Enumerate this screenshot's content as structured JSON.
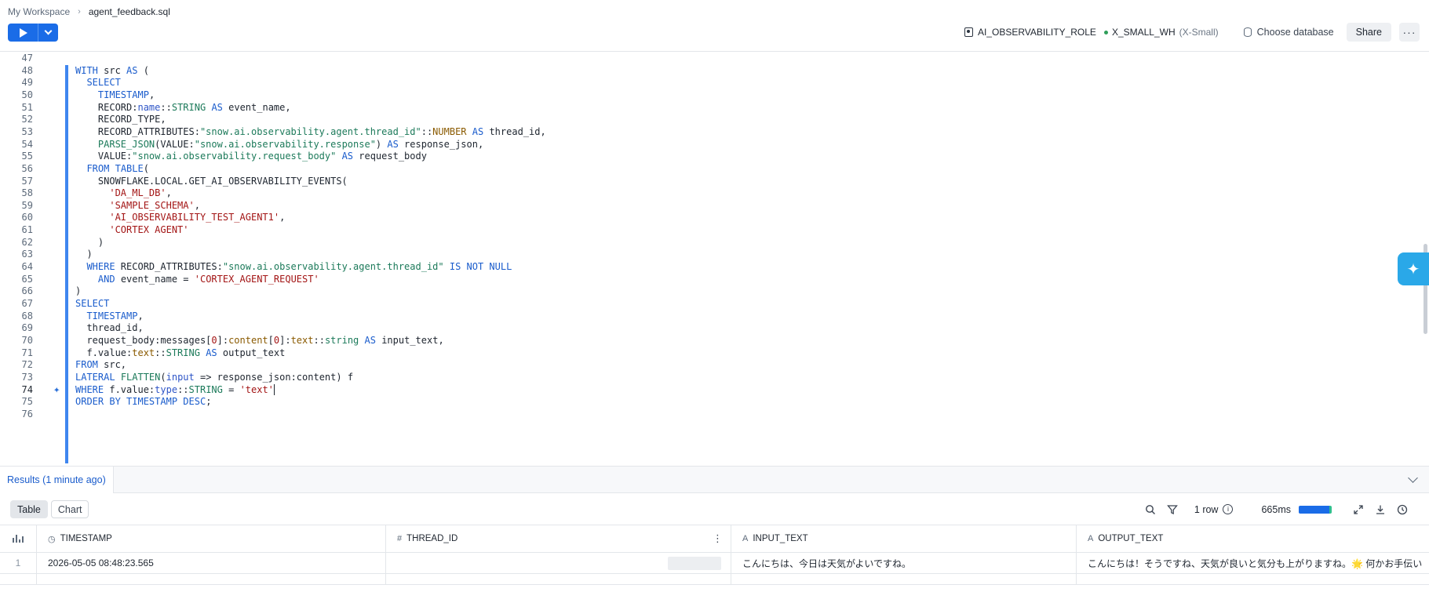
{
  "breadcrumb": {
    "workspace": "My Workspace",
    "separator": "›",
    "file": "agent_feedback.sql"
  },
  "header": {
    "role": "AI_OBSERVABILITY_ROLE",
    "warehouse": "X_SMALL_WH",
    "warehouse_size": "(X-Small)",
    "database_placeholder": "Choose database",
    "share_label": "Share",
    "more_label": "···"
  },
  "editor": {
    "active_line": 74,
    "lines": [
      {
        "n": "47",
        "html": ""
      },
      {
        "n": "48",
        "html": "<span class=\"kw\">WITH</span> src <span class=\"kw\">AS</span> ("
      },
      {
        "n": "49",
        "html": "  <span class=\"kw\">SELECT</span>"
      },
      {
        "n": "50",
        "html": "    <span class=\"kw\">TIMESTAMP</span>,"
      },
      {
        "n": "51",
        "html": "    RECORD:<span class=\"key\">name</span>::<span class=\"typ\">STRING</span> <span class=\"kw\">AS</span> event_name,"
      },
      {
        "n": "52",
        "html": "    RECORD_TYPE,"
      },
      {
        "n": "53",
        "html": "    RECORD_ATTRIBUTES:<span class=\"fn\">\"snow.ai.observability.agent.thread_id\"</span>::<span class=\"typ2\">NUMBER</span> <span class=\"kw\">AS</span> thread_id,"
      },
      {
        "n": "54",
        "html": "    <span class=\"fn\">PARSE_JSON</span>(VALUE:<span class=\"fn\">\"snow.ai.observability.response\"</span>) <span class=\"kw\">AS</span> response_json,"
      },
      {
        "n": "55",
        "html": "    VALUE:<span class=\"fn\">\"snow.ai.observability.request_body\"</span> <span class=\"kw\">AS</span> request_body"
      },
      {
        "n": "56",
        "html": "  <span class=\"kw\">FROM</span> <span class=\"kw\">TABLE</span>("
      },
      {
        "n": "57",
        "html": "    SNOWFLAKE.LOCAL.GET_AI_OBSERVABILITY_EVENTS("
      },
      {
        "n": "58",
        "html": "      <span class=\"str\">'DA_ML_DB'</span>,"
      },
      {
        "n": "59",
        "html": "      <span class=\"str\">'SAMPLE_SCHEMA'</span>,"
      },
      {
        "n": "60",
        "html": "      <span class=\"str\">'AI_OBSERVABILITY_TEST_AGENT1'</span>,"
      },
      {
        "n": "61",
        "html": "      <span class=\"str\">'CORTEX AGENT'</span>"
      },
      {
        "n": "62",
        "html": "    )"
      },
      {
        "n": "63",
        "html": "  )"
      },
      {
        "n": "64",
        "html": "  <span class=\"kw\">WHERE</span> RECORD_ATTRIBUTES:<span class=\"fn\">\"snow.ai.observability.agent.thread_id\"</span> <span class=\"kw\">IS NOT NULL</span>"
      },
      {
        "n": "65",
        "html": "    <span class=\"kw\">AND</span> event_name = <span class=\"str\">'CORTEX_AGENT_REQUEST'</span>"
      },
      {
        "n": "66",
        "html": ")"
      },
      {
        "n": "67",
        "html": "<span class=\"kw\">SELECT</span>"
      },
      {
        "n": "68",
        "html": "  <span class=\"kw\">TIMESTAMP</span>,"
      },
      {
        "n": "69",
        "html": "  thread_id,"
      },
      {
        "n": "70",
        "html": "  request_body:messages[<span class=\"str\">0</span>]:<span class=\"typ2\">content</span>[<span class=\"str\">0</span>]:<span class=\"typ2\">text</span>::<span class=\"typ\">string</span> <span class=\"kw\">AS</span> input_text,"
      },
      {
        "n": "71",
        "html": "  f.value:<span class=\"typ2\">text</span>::<span class=\"typ\">STRING</span> <span class=\"kw\">AS</span> output_text"
      },
      {
        "n": "72",
        "html": "<span class=\"kw\">FROM</span> src,"
      },
      {
        "n": "73",
        "html": "<span class=\"kw\">LATERAL</span> <span class=\"fn\">FLATTEN</span>(<span class=\"key\">input</span> => response_json:content) f"
      },
      {
        "n": "74",
        "html": "<span class=\"kw\">WHERE</span> f.value:<span class=\"key\">type</span>::<span class=\"typ\">STRING</span> = <span class=\"str\">'text'</span><span class=\"caret\"></span>"
      },
      {
        "n": "75",
        "html": "<span class=\"kw\">ORDER BY</span> <span class=\"kw\">TIMESTAMP</span> <span class=\"kw\">DESC</span>;"
      },
      {
        "n": "76",
        "html": ""
      }
    ]
  },
  "results": {
    "tab_label": "Results (1 minute ago)",
    "views": [
      "Table",
      "Chart"
    ],
    "active_view": "Table",
    "row_count": "1 row",
    "duration": "665ms",
    "duration_fraction": 0.92,
    "columns": [
      {
        "name": "TIMESTAMP",
        "icon": "datetime-icon"
      },
      {
        "name": "THREAD_ID",
        "icon": "number-icon"
      },
      {
        "name": "INPUT_TEXT",
        "icon": "text-icon"
      },
      {
        "name": "OUTPUT_TEXT",
        "icon": "text-icon"
      }
    ],
    "rows": [
      {
        "index": "1",
        "timestamp": "2026-05-05 08:48:23.565",
        "thread_id": "",
        "input_text": "こんにちは、今日は天気がよいですね。",
        "output_text": "こんにちは！そうですね、天気が良いと気分も上がりますね。🌟 何かお手伝い"
      }
    ]
  },
  "colors": {
    "accent": "#1a6ce7",
    "assistant": "#2aa8e8",
    "selection": "#3f86ef"
  }
}
